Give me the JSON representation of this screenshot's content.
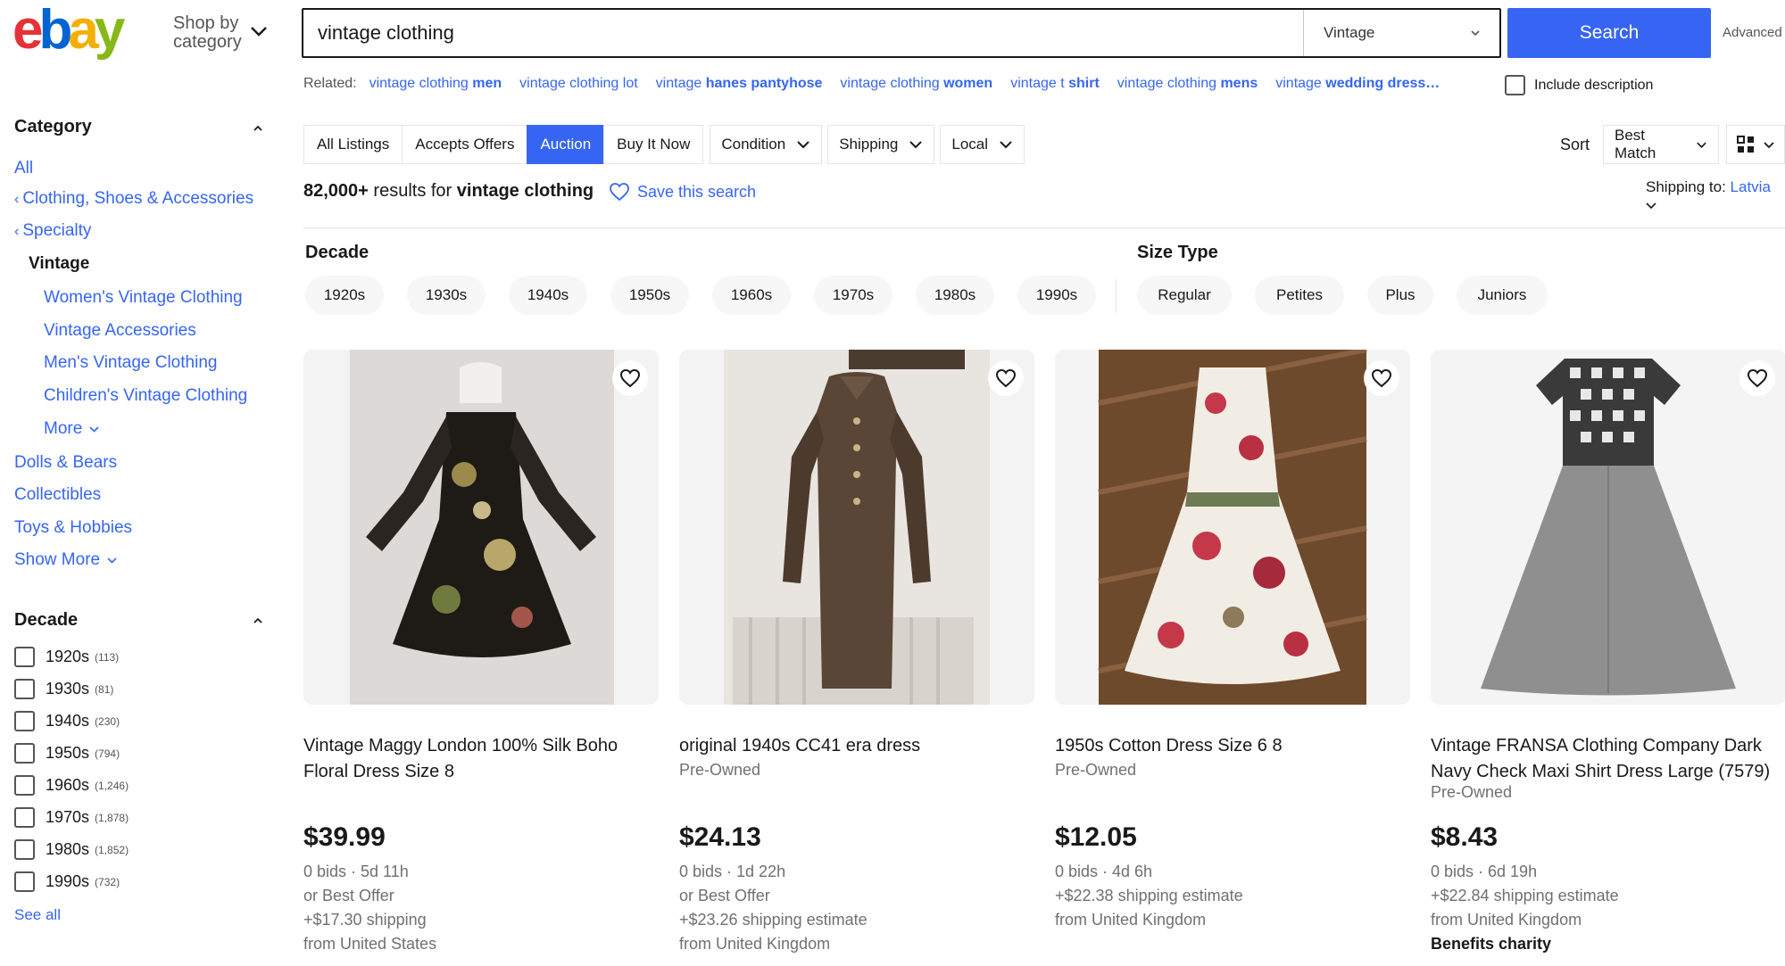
{
  "header": {
    "logo_text": "ebay",
    "shop_by_line1": "Shop by",
    "shop_by_line2": "category",
    "search_value": "vintage clothing",
    "search_category": "Vintage",
    "search_button": "Search",
    "advanced": "Advanced"
  },
  "related": {
    "label": "Related:",
    "links": [
      {
        "plain": "vintage clothing",
        "bold": "men"
      },
      {
        "plain": "vintage clothing lot",
        "bold": ""
      },
      {
        "plain": "vintage",
        "bold": "hanes pantyhose"
      },
      {
        "plain": "vintage clothing",
        "bold": "women"
      },
      {
        "plain": "vintage t",
        "bold": "shirt"
      },
      {
        "plain": "vintage clothing",
        "bold": "mens"
      },
      {
        "plain": "vintage",
        "bold": "wedding dress…"
      }
    ],
    "include_description": "Include description"
  },
  "sidebar": {
    "category_heading": "Category",
    "all": "All",
    "parent1": "Clothing, Shoes & Accessories",
    "parent2": "Specialty",
    "current": "Vintage",
    "children": [
      "Women's Vintage Clothing",
      "Vintage Accessories",
      "Men's Vintage Clothing",
      "Children's Vintage Clothing"
    ],
    "more": "More",
    "others": [
      "Dolls & Bears",
      "Collectibles",
      "Toys & Hobbies"
    ],
    "show_more": "Show More",
    "decade_heading": "Decade",
    "decades": [
      {
        "label": "1920s",
        "count": "(113)"
      },
      {
        "label": "1930s",
        "count": "(81)"
      },
      {
        "label": "1940s",
        "count": "(230)"
      },
      {
        "label": "1950s",
        "count": "(794)"
      },
      {
        "label": "1960s",
        "count": "(1,246)"
      },
      {
        "label": "1970s",
        "count": "(1,878)"
      },
      {
        "label": "1980s",
        "count": "(1,852)"
      },
      {
        "label": "1990s",
        "count": "(732)"
      }
    ],
    "see_all": "See all"
  },
  "filters": {
    "tabs": [
      "All Listings",
      "Accepts Offers",
      "Auction",
      "Buy It Now"
    ],
    "active_tab": "Auction",
    "dropdowns": [
      "Condition",
      "Shipping",
      "Local"
    ],
    "sort_label": "Sort",
    "sort_value": "Best Match"
  },
  "results": {
    "count": "82,000+",
    "middle": " results for ",
    "query": "vintage clothing",
    "save_search": "Save this search",
    "shipping_to_label": "Shipping to:",
    "shipping_to_value": "Latvia"
  },
  "aspects": {
    "decade_heading": "Decade",
    "decades": [
      "1920s",
      "1930s",
      "1940s",
      "1950s",
      "1960s",
      "1970s",
      "1980s",
      "1990s"
    ],
    "size_type_heading": "Size Type",
    "size_types": [
      "Regular",
      "Petites",
      "Plus",
      "Juniors"
    ]
  },
  "listings": [
    {
      "title": "Vintage Maggy London 100% Silk Boho Floral Dress Size 8",
      "condition": "",
      "price": "$39.99",
      "details": [
        "0 bids · 5d 11h",
        "or Best Offer",
        "+$17.30 shipping",
        "from United States"
      ],
      "charity": ""
    },
    {
      "title": "original 1940s CC41 era dress",
      "condition": "Pre-Owned",
      "price": "$24.13",
      "details": [
        "0 bids · 1d 22h",
        "or Best Offer",
        "+$23.26 shipping estimate",
        "from United Kingdom"
      ],
      "charity": ""
    },
    {
      "title": "1950s Cotton Dress Size 6 8",
      "condition": "Pre-Owned",
      "price": "$12.05",
      "details": [
        "0 bids · 4d 6h",
        "+$22.38 shipping estimate",
        "from United Kingdom"
      ],
      "charity": ""
    },
    {
      "title": "Vintage FRANSA Clothing Company Dark Navy Check Maxi Shirt Dress Large (7579)",
      "condition": "Pre-Owned",
      "price": "$8.43",
      "details": [
        "0 bids · 6d 19h",
        "+$22.84 shipping estimate",
        "from United Kingdom"
      ],
      "charity": "Benefits charity"
    }
  ],
  "colors": {
    "ebay_red": "#e53238",
    "ebay_blue": "#0064d2",
    "ebay_yellow": "#f5af02",
    "ebay_green": "#86b817",
    "link_blue": "#3665f3"
  }
}
